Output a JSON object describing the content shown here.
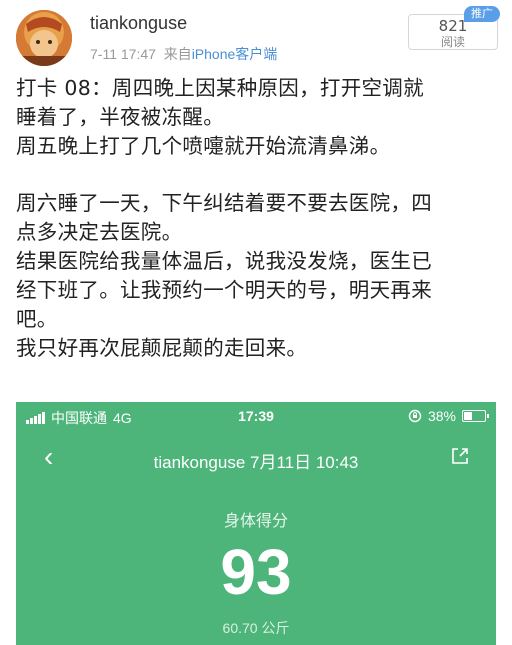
{
  "post": {
    "username": "tiankonguse",
    "time": "7-11 17:47",
    "source_prefix": "来自",
    "source": "iPhone客户端",
    "reads_count": "821",
    "reads_label": "阅读",
    "promo_badge": "推广",
    "lines": [
      "打卡 08：周四晚上因某种原因，打开空调就",
      "睡着了，半夜被冻醒。",
      "周五晚上打了几个喷嚏就开始流清鼻涕。",
      "",
      "周六睡了一天，下午纠结着要不要去医院，四",
      "点多决定去医院。",
      "结果医院给我量体温后，说我没发烧，医生已",
      "经下班了。让我预约一个明天的号，明天再来",
      "吧。",
      "我只好再次屁颠屁颠的走回来。"
    ]
  },
  "screenshot": {
    "status_bar": {
      "carrier": "中国联通",
      "network": "4G",
      "time": "17:39",
      "battery": "38%",
      "battery_level": 0.38
    },
    "nav_title": "tiankonguse 7月11日 10:43",
    "score_label": "身体得分",
    "score": "93",
    "weight": "60.70 公斤"
  },
  "colors": {
    "link": "#4a8fd6",
    "screenshot_bg": "#4db57a",
    "promo_badge": "#5b9ee8"
  }
}
